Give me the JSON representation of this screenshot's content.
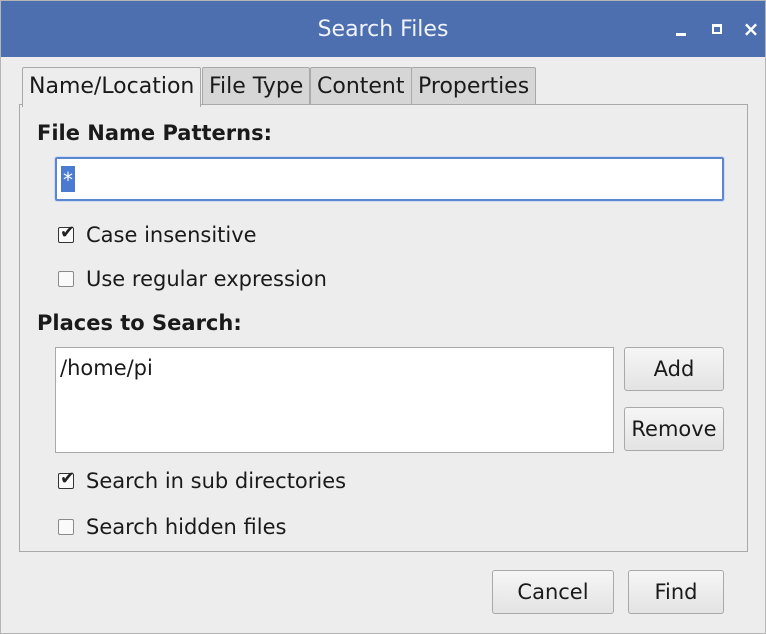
{
  "window": {
    "title": "Search Files",
    "controls": {
      "minimize": "_",
      "maximize": "□",
      "close": "×"
    }
  },
  "tabs": [
    {
      "label": "Name/Location",
      "active": true
    },
    {
      "label": "File Type",
      "active": false
    },
    {
      "label": "Content",
      "active": false
    },
    {
      "label": "Properties",
      "active": false
    }
  ],
  "name_section": {
    "heading": "File Name Patterns:",
    "pattern_value": "*",
    "case_insensitive": {
      "label": "Case insensitive",
      "checked": true
    },
    "use_regex": {
      "label": "Use regular expression",
      "checked": false
    }
  },
  "places_section": {
    "heading": "Places to Search:",
    "places": [
      "/home/pi"
    ],
    "add_label": "Add",
    "remove_label": "Remove",
    "sub_dirs": {
      "label": "Search in sub directories",
      "checked": true
    },
    "hidden_files": {
      "label": "Search hidden files",
      "checked": false
    }
  },
  "footer": {
    "cancel_label": "Cancel",
    "find_label": "Find"
  },
  "colors": {
    "titlebar": "#4d6fb0",
    "selection": "#4b7ad1",
    "focus_border": "#5b87d0"
  }
}
